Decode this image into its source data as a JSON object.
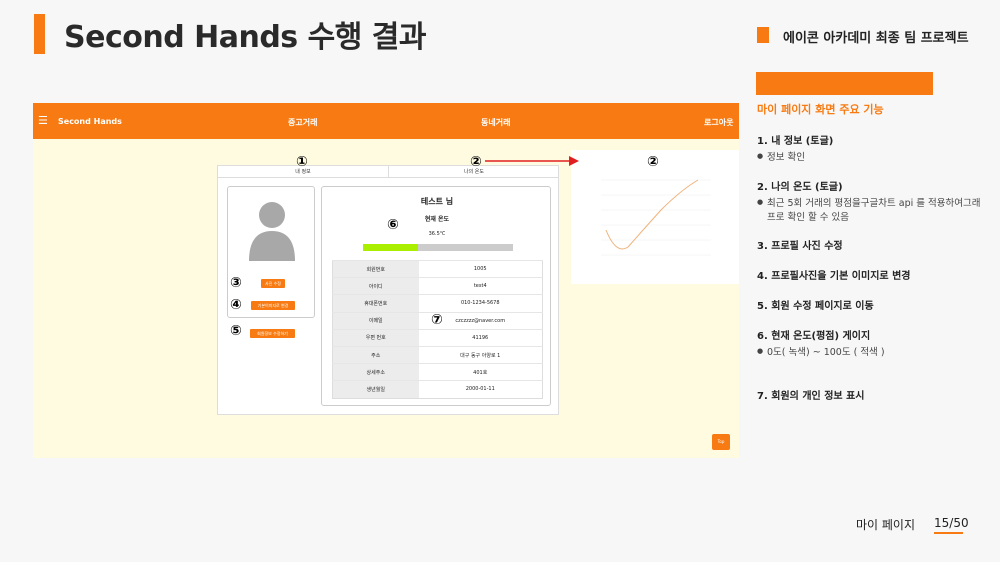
{
  "slide": {
    "title": "Second Hands 수행 결과",
    "project": "에이콘 아카데미 최종 팀 프로젝트",
    "footer_label": "마이 페이지",
    "page": "15/50",
    "accent_color": "#f77b12"
  },
  "panel": {
    "heading": "마이 페이지 화면 주요 기능",
    "features": [
      {
        "title": "1. 내 정보 (토글)",
        "bullet": "정보 확인"
      },
      {
        "title": "2. 나의 온도 (토글)",
        "bullet": "최근 5회 거래의 평점을구글차트 api 를 적용하여그래프로 확인 할 수 있음"
      },
      {
        "title": "3. 프로필 사진 수정",
        "bullet": ""
      },
      {
        "title": "4. 프로필사진을 기본 이미지로 변경",
        "bullet": ""
      },
      {
        "title": "5. 회원 수정 페이지로 이동",
        "bullet": ""
      },
      {
        "title": "6. 현재 온도(평점) 게이지",
        "bullet": "0도( 녹색) ~ 100도 ( 적색 )"
      },
      {
        "title": "7. 회원의 개인 정보 표시",
        "bullet": ""
      }
    ]
  },
  "app": {
    "nav": {
      "menu_icon": "☰",
      "brand": "Second Hands",
      "items": [
        "중고거래",
        "동네거래",
        "로그아웃"
      ]
    },
    "tabs": [
      "내 정보",
      "나의 온도"
    ],
    "profile": {
      "buttons": [
        "사진 수정",
        "기본이미지로 변경",
        "회원정보 수정하기"
      ]
    },
    "info": {
      "name": "테스트 님",
      "temp_label": "현재 온도",
      "temp_value": "36.5℃",
      "temp_fraction": 0.365,
      "rows": [
        {
          "key": "회원번호",
          "value": "1005"
        },
        {
          "key": "아이디",
          "value": "test4"
        },
        {
          "key": "휴대폰번호",
          "value": "010-1234-5678"
        },
        {
          "key": "이메일",
          "value": "czczzzz@naver.com"
        },
        {
          "key": "우편 번호",
          "value": "41196"
        },
        {
          "key": "주소",
          "value": "대구 동구 아양로 1"
        },
        {
          "key": "상세주소",
          "value": "401호"
        },
        {
          "key": "생년월일",
          "value": "2000-01-11"
        }
      ]
    },
    "top_button": "Top"
  },
  "markers": [
    "①",
    "②",
    "②",
    "③",
    "④",
    "⑤",
    "⑥",
    "⑦"
  ]
}
